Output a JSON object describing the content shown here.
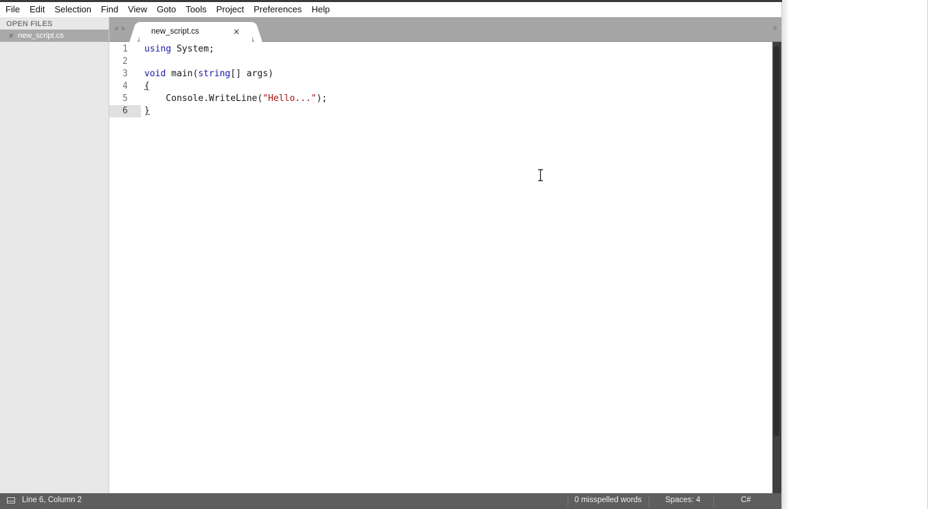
{
  "menubar": {
    "items": [
      "File",
      "Edit",
      "Selection",
      "Find",
      "View",
      "Goto",
      "Tools",
      "Project",
      "Preferences",
      "Help"
    ]
  },
  "sidebar": {
    "header": "OPEN FILES",
    "files": [
      {
        "name": "new_script.cs",
        "close_glyph": "×"
      }
    ]
  },
  "tabs": {
    "nav_back_glyph": "◀",
    "nav_forward_glyph": "▶",
    "active": {
      "label": "new_script.cs",
      "close_glyph": "×"
    },
    "menu_glyph": "▼"
  },
  "editor": {
    "current_line": 6,
    "lines": [
      {
        "num": "1",
        "text": "using System;"
      },
      {
        "num": "2",
        "text": ""
      },
      {
        "num": "3",
        "text": "void main(string[] args)"
      },
      {
        "num": "4",
        "text": "{"
      },
      {
        "num": "5",
        "text": "    Console.WriteLine(\"Hello...\");"
      },
      {
        "num": "6",
        "text": "}"
      }
    ],
    "colors": {
      "keyword": "#1a1aa6",
      "string": "#a31515"
    }
  },
  "statusbar": {
    "position": "Line 6, Column 2",
    "spelling": "0 misspelled words",
    "indentation": "Spaces: 4",
    "syntax": "C#"
  }
}
